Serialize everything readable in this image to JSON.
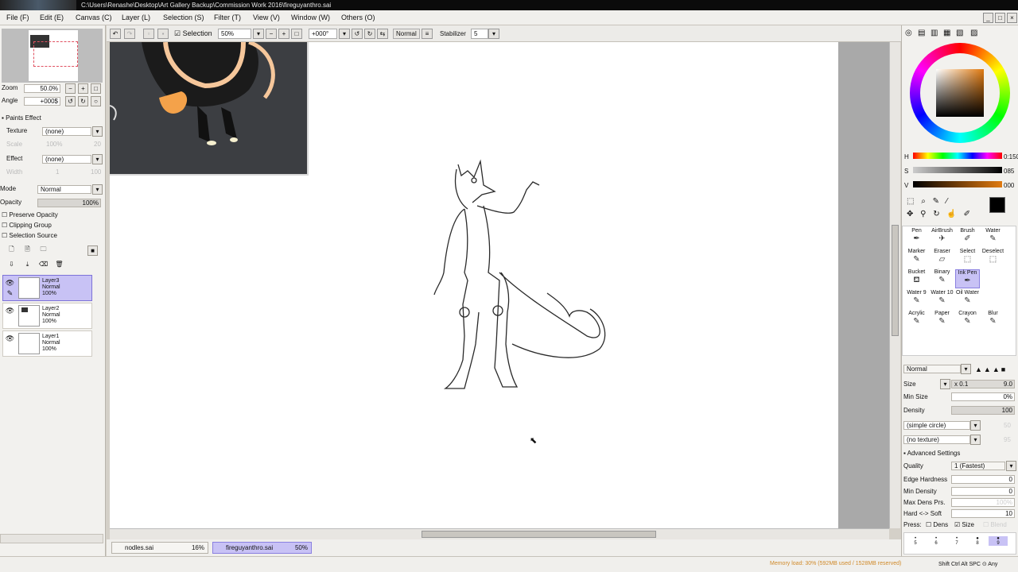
{
  "titlebar": {
    "path": "C:\\Users\\Renashe\\Desktop\\Art Gallery Backup\\Commission Work 2016\\fireguyanthro.sai"
  },
  "menu": [
    "File (F)",
    "Edit (E)",
    "Canvas (C)",
    "Layer (L)",
    "Selection (S)",
    "Filter (T)",
    "View (V)",
    "Window (W)",
    "Others (O)"
  ],
  "window_buttons": [
    "_",
    "□",
    "×"
  ],
  "navigator": {
    "zoom_label": "Zoom",
    "zoom_value": "50.0%",
    "angle_label": "Angle",
    "angle_value": "+000$"
  },
  "paints_effect": {
    "header": "Paints Effect",
    "texture_label": "Texture",
    "texture_value": "(none)",
    "effect_label": "Effect",
    "effect_value": "(none)",
    "scale_label": "Scale",
    "scale_value": "100%",
    "scale_num": "20",
    "width_label": "Width",
    "width_value": "1",
    "width_num": "100"
  },
  "layer_props": {
    "mode_label": "Mode",
    "mode_value": "Normal",
    "opacity_label": "Opacity",
    "opacity_value": "100%",
    "preserve_opacity": "Preserve Opacity",
    "clipping_group": "Clipping Group",
    "selection_source": "Selection Source"
  },
  "layers": [
    {
      "name": "Layer3",
      "mode": "Normal",
      "opacity": "100%"
    },
    {
      "name": "Layer2",
      "mode": "Normal",
      "opacity": "100%"
    },
    {
      "name": "Layer1",
      "mode": "Normal",
      "opacity": "100%"
    }
  ],
  "toolbar": {
    "selection_label": "Selection",
    "zoom": "50%",
    "angle": "+000°",
    "blend": "Normal",
    "stabilizer_label": "Stabilizer",
    "stabilizer_value": "5"
  },
  "tabs": [
    {
      "name": "nodles.sai",
      "pct": "16%"
    },
    {
      "name": "fireguyanthro.sai",
      "pct": "50%"
    }
  ],
  "status": {
    "memory": "Memory load: 30% (592MB used / 1528MB reserved)",
    "keys": "Shift Ctrl Alt SPC ⊙ Any"
  },
  "color": {
    "h_label": "H",
    "h_value": "0:150",
    "s_label": "S",
    "s_value": "085",
    "v_label": "V",
    "v_value": "000",
    "accent": "#c8c2f5"
  },
  "tools": [
    [
      "Pen",
      "AirBrush",
      "Brush",
      "Water"
    ],
    [
      "Marker",
      "Eraser",
      "Select",
      "Deselect"
    ],
    [
      "Bucket",
      "Binary",
      "Ink Pen",
      ""
    ],
    [
      "Water 9",
      "Water 10",
      "Oil Water",
      ""
    ],
    [
      "Acrylic",
      "Paper",
      "Crayon",
      "Blur"
    ]
  ],
  "brush": {
    "mode": "Normal",
    "size_label": "Size",
    "size_mult": "x 0.1",
    "size_value": "9.0",
    "minsize_label": "Min Size",
    "minsize_value": "0%",
    "density_label": "Density",
    "density_value": "100",
    "shape": "(simple circle)",
    "shape_num": "50",
    "texture": "(no texture)",
    "texture_num": "95",
    "advanced": "Advanced Settings",
    "quality_label": "Quality",
    "quality_value": "1 (Fastest)",
    "edge_label": "Edge Hardness",
    "edge_value": "0",
    "mindens_label": "Min Density",
    "mindens_value": "0",
    "maxdens_label": "Max Dens Prs.",
    "maxdens_value": "100%",
    "hardsoft_label": "Hard <-> Soft",
    "hardsoft_value": "10",
    "press_label": "Press:",
    "dens_label": "Dens",
    "size2_label": "Size",
    "blend_label": "Blend"
  },
  "presets": [
    "5",
    "6",
    "7",
    "8",
    "9"
  ]
}
